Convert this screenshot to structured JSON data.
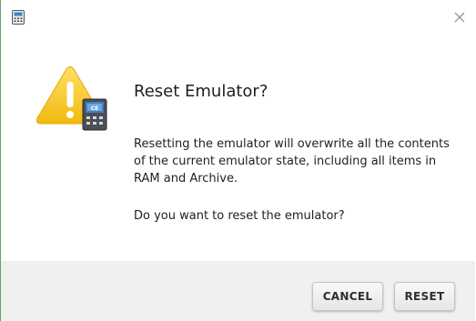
{
  "window": {
    "app_icon": "calculator-emulator-icon",
    "close_icon": "close-icon"
  },
  "dialog": {
    "icon": "warning-icon",
    "badge_text": "CE",
    "title": "Reset Emulator?",
    "message": "Resetting the emulator will overwrite all the contents of the current emulator state, including all items in RAM and Archive.",
    "question": "Do you want to reset the emulator?"
  },
  "buttons": {
    "cancel_label": "CANCEL",
    "reset_label": "RESET"
  },
  "colors": {
    "warning_yellow": "#f7c21c",
    "badge_blue": "#3d7fc4",
    "footer_bg": "#f0f0f0"
  }
}
